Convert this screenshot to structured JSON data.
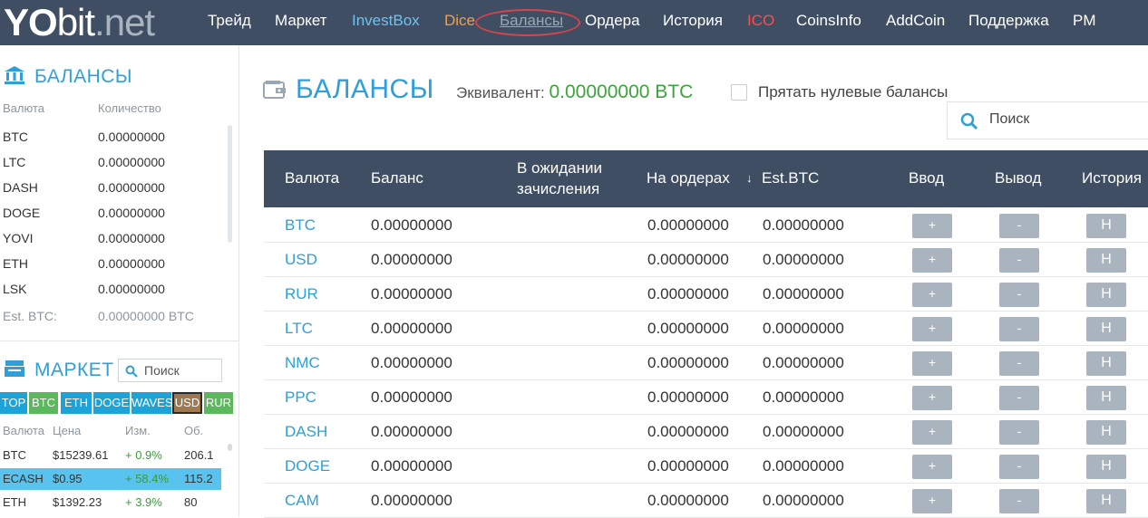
{
  "logo": {
    "yo": "YO",
    "bit": "bit",
    "net": ".net"
  },
  "nav": [
    {
      "label": "Трейд",
      "color": "#ffffff"
    },
    {
      "label": "Маркет",
      "color": "#ffffff"
    },
    {
      "label": "InvestBox",
      "color": "#6ec3f0"
    },
    {
      "label": "Dice",
      "color": "#f0a050"
    },
    {
      "label": "Балансы",
      "color": "#9aa6b2"
    },
    {
      "label": "Ордера",
      "color": "#ffffff"
    },
    {
      "label": "История",
      "color": "#ffffff"
    },
    {
      "label": "ICO",
      "color": "#ff4d4d"
    },
    {
      "label": "CoinsInfo",
      "color": "#ffffff"
    },
    {
      "label": "AddCoin",
      "color": "#ffffff"
    },
    {
      "label": "Поддержка",
      "color": "#ffffff"
    },
    {
      "label": "PM",
      "color": "#ffffff"
    }
  ],
  "sidebar": {
    "balances_title": "БАЛАНСЫ",
    "col_currency": "Валюта",
    "col_amount": "Количество",
    "rows": [
      {
        "cur": "BTC",
        "amt": "0.00000000"
      },
      {
        "cur": "LTC",
        "amt": "0.00000000"
      },
      {
        "cur": "DASH",
        "amt": "0.00000000"
      },
      {
        "cur": "DOGE",
        "amt": "0.00000000"
      },
      {
        "cur": "YOVI",
        "amt": "0.00000000"
      },
      {
        "cur": "ETH",
        "amt": "0.00000000"
      },
      {
        "cur": "LSK",
        "amt": "0.00000000"
      }
    ],
    "est_label": "Est. BTC:",
    "est_value": "0.00000000 BTC",
    "market_title": "МАРКЕТ",
    "market_search_placeholder": "Поиск",
    "market_tabs": [
      {
        "label": "TOP",
        "color": "#1ea3d9"
      },
      {
        "label": "BTC",
        "color": "#5cb85c"
      },
      {
        "label": "ETH",
        "color": "#1ea3d9"
      },
      {
        "label": "DOGE",
        "color": "#1ea3d9"
      },
      {
        "label": "WAVES",
        "color": "#1ea3d9"
      },
      {
        "label": "USD",
        "color": "#a07850"
      },
      {
        "label": "RUR",
        "color": "#5cb85c"
      }
    ],
    "market_cols": {
      "cur": "Валюта",
      "price": "Цена",
      "change": "Изм.",
      "vol": "Об."
    },
    "market_rows": [
      {
        "cur": "BTC",
        "price": "$15239.61",
        "change": "+ 0.9%",
        "vol": "206.1",
        "highlight": false
      },
      {
        "cur": "ECASH",
        "price": "$0.95",
        "change": "+ 58.4%",
        "vol": "115.2",
        "highlight": true
      },
      {
        "cur": "ETH",
        "price": "$1392.23",
        "change": "+ 3.9%",
        "vol": "80",
        "highlight": false
      }
    ]
  },
  "main": {
    "title": "БАЛАНСЫ",
    "equiv_label": "Эквивалент:",
    "equiv_value": "0.00000000 BTC",
    "hide_zero_label": "Прятать нулевые балансы",
    "search_placeholder": "Поиск",
    "headers": {
      "currency": "Валюта",
      "balance": "Баланс",
      "pending_line1": "В ожидании",
      "pending_line2": "зачисления",
      "orders": "На ордерах",
      "est_btc": "Est.BTC",
      "deposit": "Ввод",
      "withdraw": "Вывод",
      "history": "История"
    },
    "btn_deposit": "+",
    "btn_withdraw": "-",
    "btn_history": "H",
    "rows": [
      {
        "cur": "BTC",
        "balance": "0.00000000",
        "orders": "0.00000000",
        "est": "0.00000000"
      },
      {
        "cur": "USD",
        "balance": "0.00000000",
        "orders": "0.00000000",
        "est": "0.00000000"
      },
      {
        "cur": "RUR",
        "balance": "0.00000000",
        "orders": "0.00000000",
        "est": "0.00000000"
      },
      {
        "cur": "LTC",
        "balance": "0.00000000",
        "orders": "0.00000000",
        "est": "0.00000000"
      },
      {
        "cur": "NMC",
        "balance": "0.00000000",
        "orders": "0.00000000",
        "est": "0.00000000"
      },
      {
        "cur": "PPC",
        "balance": "0.00000000",
        "orders": "0.00000000",
        "est": "0.00000000"
      },
      {
        "cur": "DASH",
        "balance": "0.00000000",
        "orders": "0.00000000",
        "est": "0.00000000"
      },
      {
        "cur": "DOGE",
        "balance": "0.00000000",
        "orders": "0.00000000",
        "est": "0.00000000"
      },
      {
        "cur": "CAM",
        "balance": "0.00000000",
        "orders": "0.00000000",
        "est": "0.00000000"
      }
    ]
  }
}
